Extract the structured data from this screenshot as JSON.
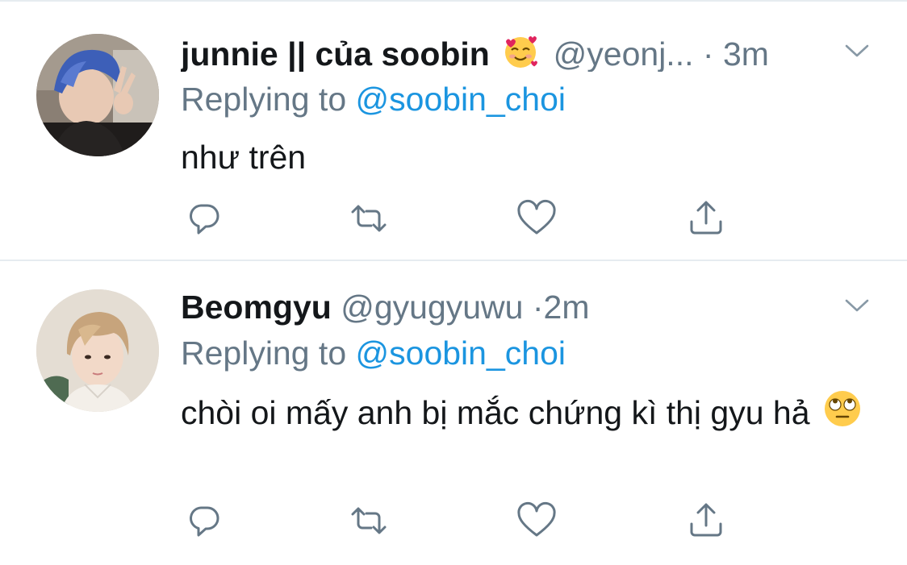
{
  "tweets": [
    {
      "display_name": "junnie || của soobin",
      "name_emoji": "smiling-face-with-hearts",
      "handle": "@yeonj...",
      "separator": "·",
      "time": "3m",
      "replying_prefix": "Replying to",
      "replying_to": "@soobin_choi",
      "text": "như trên",
      "text_emoji": ""
    },
    {
      "display_name": "Beomgyu",
      "name_emoji": "",
      "handle": "@gyugyuwu",
      "separator": "·",
      "time": "2m",
      "replying_prefix": "Replying to",
      "replying_to": "@soobin_choi",
      "text": "chòi oi mấy anh bị mắc chứng kì thị gyu hả",
      "text_emoji": "face-with-rolling-eyes"
    }
  ],
  "icons": {
    "reply": "reply-icon",
    "retweet": "retweet-icon",
    "like": "like-icon",
    "share": "share-icon",
    "more": "chevron-down-icon"
  },
  "colors": {
    "text": "#14171a",
    "secondary": "#657786",
    "link": "#1b95e0",
    "divider": "#e6ecf0"
  }
}
